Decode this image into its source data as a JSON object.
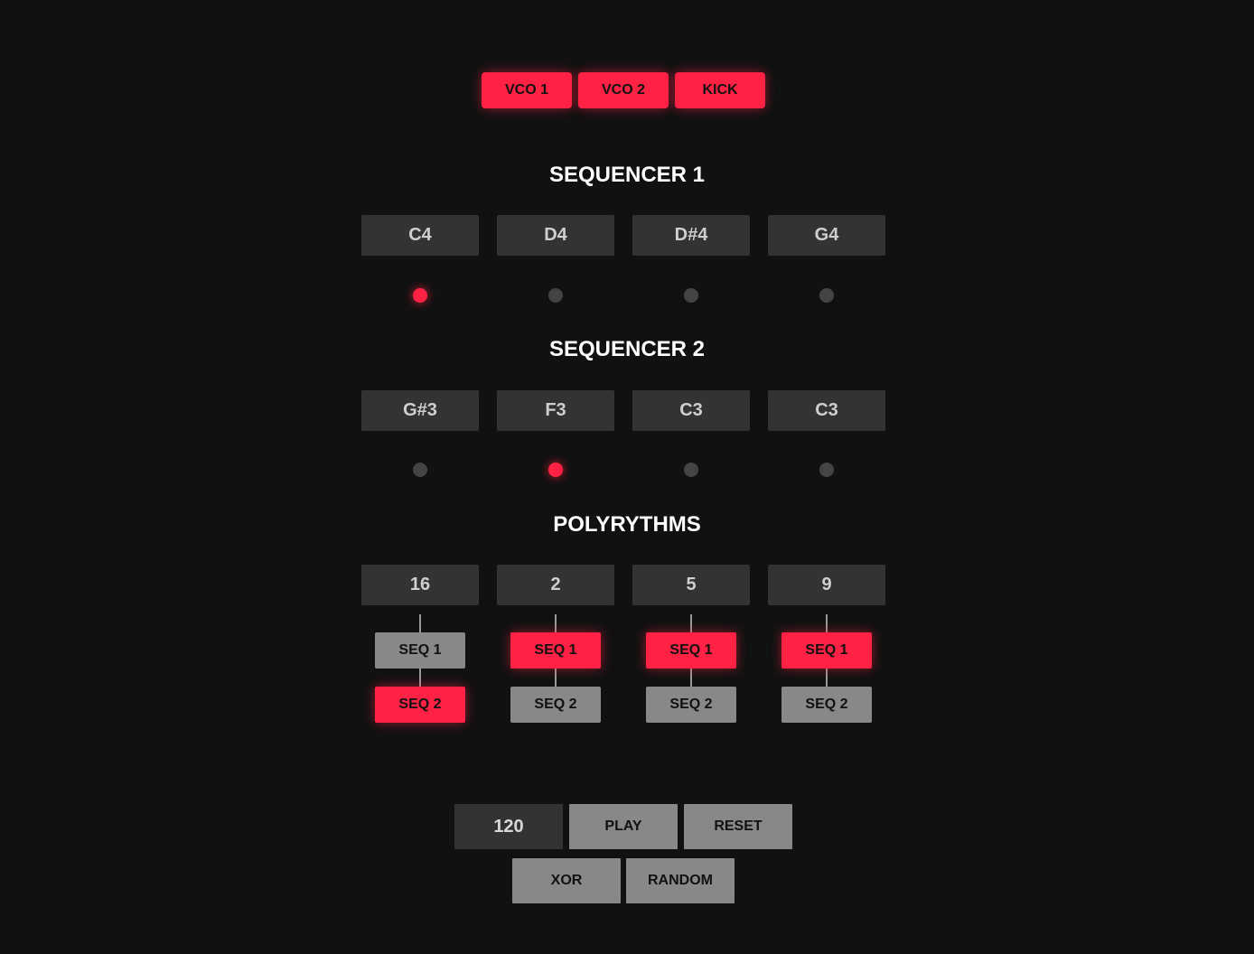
{
  "voices": [
    "VCO 1",
    "VCO 2",
    "KICK"
  ],
  "sequencer1": {
    "title": "SEQUENCER 1",
    "notes": [
      "C4",
      "D4",
      "D#4",
      "G4"
    ],
    "active_step": 0
  },
  "sequencer2": {
    "title": "SEQUENCER 2",
    "notes": [
      "G#3",
      "F3",
      "C3",
      "C3"
    ],
    "active_step": 1
  },
  "polyrhythms": {
    "title": "POLYRYTHMS",
    "values": [
      "16",
      "2",
      "5",
      "9"
    ],
    "seq1_label": "SEQ 1",
    "seq2_label": "SEQ 2",
    "routing": [
      "seq2",
      "seq1",
      "seq1",
      "seq1"
    ]
  },
  "controls": {
    "bpm": "120",
    "play_label": "PLAY",
    "reset_label": "RESET",
    "xor_label": "XOR",
    "random_label": "RANDOM"
  },
  "colors": {
    "accent": "#ff2244",
    "background": "#111111",
    "panel": "#333333",
    "inactive": "#888888"
  }
}
